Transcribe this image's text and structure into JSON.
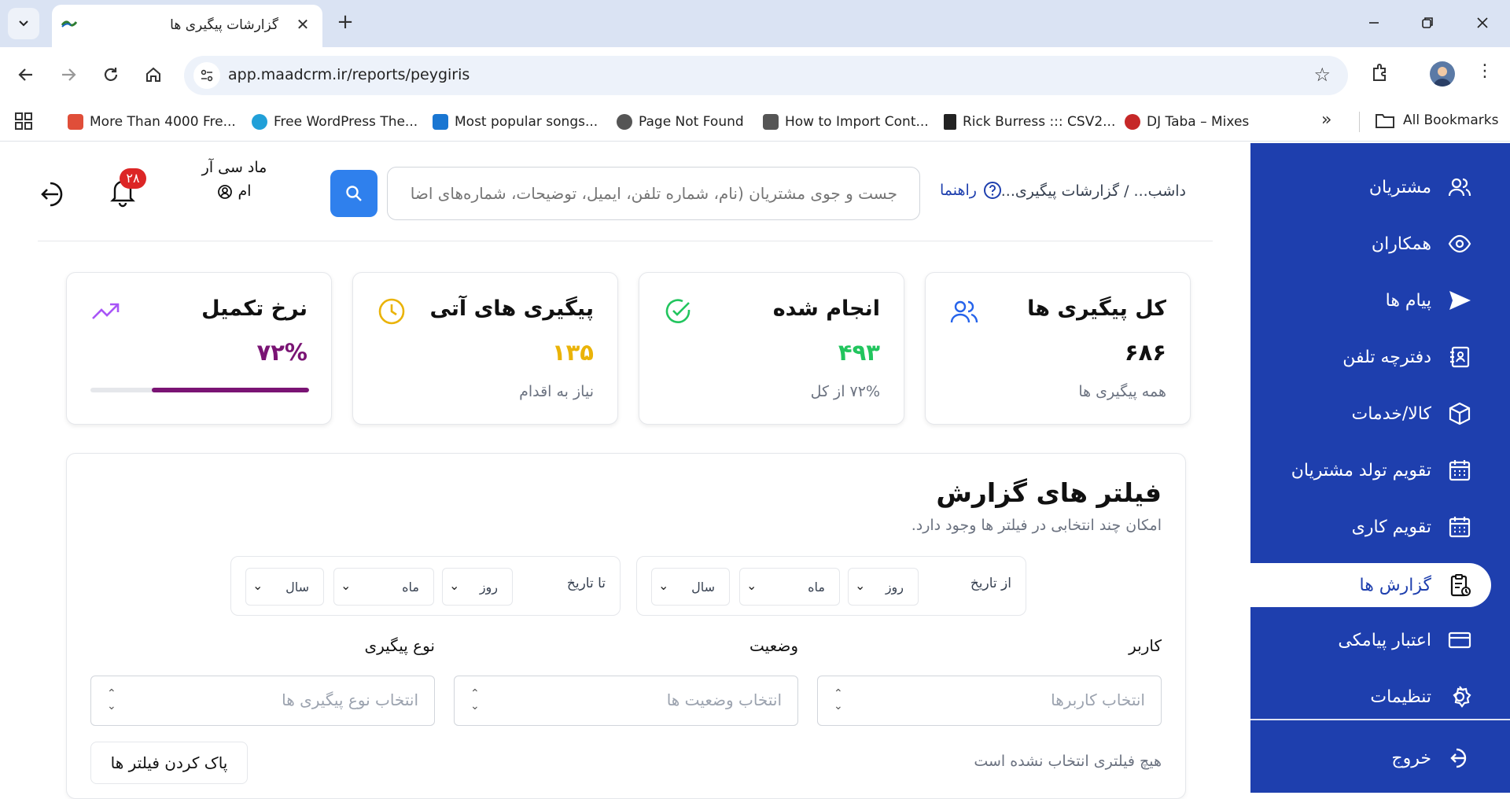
{
  "browser": {
    "tab_title": "گزارشات پیگیری ها",
    "url": "app.maadcrm.ir/reports/peygiris",
    "bookmarks": [
      {
        "label": "More Than 4000 Fre...",
        "icon": "joomla-icon",
        "color": "#e04e39"
      },
      {
        "label": "Free WordPress The...",
        "icon": "globe-blue-icon",
        "color": "#21a0d8"
      },
      {
        "label": "Most popular songs...",
        "icon": "mp3-icon",
        "color": "#1976d2"
      },
      {
        "label": "Page Not Found",
        "icon": "globe-icon",
        "color": "#555555"
      },
      {
        "label": "How to Import Cont...",
        "icon": "briefcase-icon",
        "color": "#555555"
      },
      {
        "label": "Rick Burress ::: CSV2...",
        "icon": "feather-icon",
        "color": "#222222"
      },
      {
        "label": "DJ Taba – Mixes",
        "icon": "dj-icon",
        "color": "#c62828"
      }
    ],
    "all_bookmarks": "All Bookmarks"
  },
  "sidebar": {
    "items": [
      {
        "label": "مشتریان",
        "icon": "users-icon"
      },
      {
        "label": "همکاران",
        "icon": "eye-icon"
      },
      {
        "label": "پیام ها",
        "icon": "send-icon"
      },
      {
        "label": "دفترچه تلفن",
        "icon": "phonebook-icon"
      },
      {
        "label": "کالا/خدمات",
        "icon": "box-icon"
      },
      {
        "label": "تقویم تولد مشتریان",
        "icon": "calendar-icon"
      },
      {
        "label": "تقویم کاری",
        "icon": "calendar-icon"
      },
      {
        "label": "گزارش ها",
        "icon": "report-icon",
        "active": true
      },
      {
        "label": "اعتبار پیامکی",
        "icon": "card-icon"
      },
      {
        "label": "تنظیمات",
        "icon": "gear-icon"
      }
    ],
    "logout": "خروج"
  },
  "header": {
    "breadcrumb": "داشب...  /  گزارشات پیگیری...",
    "help": "راهنما",
    "search_placeholder": "جست و جوی مشتریان (نام، شماره تلفن، ایمیل، توضیحات، شماره‌های اضا",
    "user_name": "ماد سی آر ام",
    "notifications": "۲۸"
  },
  "stats": [
    {
      "title": "کل پیگیری ها",
      "value": "۶۸۶",
      "sub": "همه پیگیری ها",
      "value_color": "#111111",
      "icon": "users-icon",
      "icon_color": "#2563eb"
    },
    {
      "title": "انجام شده",
      "value": "۴۹۳",
      "sub": "۷۲% از کل",
      "value_color": "#22c55e",
      "icon": "check-circle-icon",
      "icon_color": "#22c55e"
    },
    {
      "title": "پیگیری های آتی",
      "value": "۱۳۵",
      "sub": "نیاز به اقدام",
      "value_color": "#eab308",
      "icon": "clock-icon",
      "icon_color": "#eab308"
    },
    {
      "title": "نرخ تکمیل",
      "value": "۷۲%",
      "sub": "",
      "value_color": "#7a1474",
      "icon": "trending-up-icon",
      "icon_color": "#a855f7",
      "progress": 0.72
    }
  ],
  "filters": {
    "title": "فیلتر های گزارش",
    "subtitle": "امکان چند انتخابی در فیلتر ها وجود دارد.",
    "from_label": "از تاریخ",
    "to_label": "تا تاریخ",
    "day": "روز",
    "month": "ماه",
    "year": "سال",
    "user_label": "کاربر",
    "user_placeholder": "انتخاب کاربرها",
    "status_label": "وضعیت",
    "status_placeholder": "انتخاب وضعیت ها",
    "type_label": "نوع پیگیری",
    "type_placeholder": "انتخاب نوع پیگیری ها",
    "no_filter": "هیچ فیلتری انتخاب نشده است",
    "clear": "پاک کردن فیلتر ها"
  }
}
